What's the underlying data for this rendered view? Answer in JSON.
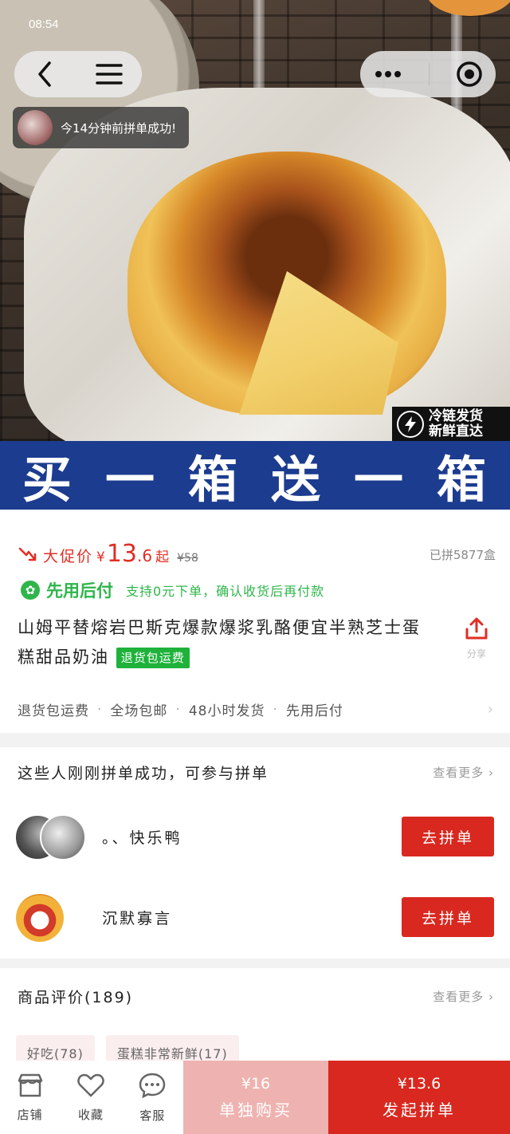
{
  "status": {
    "time": "08:54"
  },
  "nav": {
    "back_icon": "chevron-left-icon",
    "menu_icon": "menu-icon",
    "more_icon": "more-dots-icon",
    "record_icon": "target-icon"
  },
  "ticker": {
    "text": "今14分钟前拼单成功!"
  },
  "hero_badge": {
    "line1": "冷链发货",
    "line2": "新鲜直达"
  },
  "promo_banner": {
    "chars": [
      "买",
      "一",
      "箱",
      "送",
      "一",
      "箱"
    ]
  },
  "price": {
    "label": "大促价",
    "currency": "¥",
    "integer": "13",
    "decimal": ".6",
    "suffix": "起",
    "original": "¥58",
    "sold": "已拼5877盒",
    "accent_color": "#e02e24"
  },
  "paylater": {
    "title": "先用后付",
    "desc": "支持0元下单，确认收货后再付款",
    "color": "#2fb54a"
  },
  "product": {
    "title": "山姆平替熔岩巴斯克爆款爆浆乳酪便宜半熟芝士蛋糕甜品奶油",
    "tag": "退货包运费",
    "share_label": "分享"
  },
  "services": [
    "退货包运费",
    "全场包邮",
    "48小时发货",
    "先用后付"
  ],
  "group": {
    "heading": "这些人刚刚拼单成功，可参与拼单",
    "more": "查看更多",
    "rows": [
      {
        "name": "。、快乐鸭",
        "button": "去拼单"
      },
      {
        "name": "沉默寡言",
        "button": "去拼单"
      }
    ]
  },
  "reviews": {
    "heading": "商品评价(189)",
    "more": "查看更多",
    "tags": [
      "好吃(78)",
      "蛋糕非常新鲜(17)"
    ]
  },
  "bottom": {
    "tabs": [
      {
        "label": "店铺",
        "icon": "store-icon"
      },
      {
        "label": "收藏",
        "icon": "heart-icon"
      },
      {
        "label": "客服",
        "icon": "chat-icon"
      }
    ],
    "single": {
      "price": "¥16",
      "label": "单独购买"
    },
    "group": {
      "price": "¥13.6",
      "label": "发起拼单"
    },
    "single_color": "#eeb3b0",
    "group_color": "#d9281f"
  }
}
